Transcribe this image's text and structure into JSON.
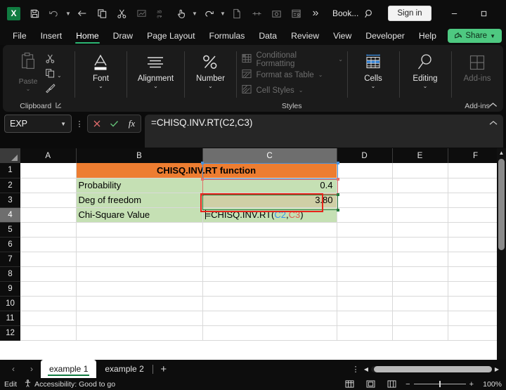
{
  "titlebar": {
    "app_logo": "excel-logo",
    "document_name": "Book...",
    "quick_access": [
      {
        "name": "save-icon",
        "label": "Save"
      },
      {
        "name": "undo-icon",
        "label": "Undo"
      },
      {
        "name": "back-arrow-icon",
        "label": "Back"
      },
      {
        "name": "copy-icon",
        "label": "Copy"
      },
      {
        "name": "cut-scissors-icon",
        "label": "Cut"
      },
      {
        "name": "chart-icon",
        "label": "Insert Chart"
      },
      {
        "name": "spelling-abc-icon",
        "label": "Spelling"
      },
      {
        "name": "touch-mode-icon",
        "label": "Touch/Mouse Mode"
      },
      {
        "name": "redo-icon",
        "label": "Redo"
      },
      {
        "name": "new-file-icon",
        "label": "New"
      },
      {
        "name": "merge-cells-icon",
        "label": "Merge"
      },
      {
        "name": "screenshot-icon",
        "label": "Screenshot"
      },
      {
        "name": "form-icon",
        "label": "Form"
      },
      {
        "name": "more-commands-icon",
        "label": "More"
      }
    ],
    "search_icon": "search-icon",
    "signin_label": "Sign in",
    "window_buttons": {
      "minimize": "–",
      "maximize": "◻",
      "close": "✕"
    }
  },
  "ribbon_tabs": {
    "items": [
      {
        "label": "File",
        "active": false
      },
      {
        "label": "Insert",
        "active": false
      },
      {
        "label": "Home",
        "active": true
      },
      {
        "label": "Draw",
        "active": false
      },
      {
        "label": "Page Layout",
        "active": false
      },
      {
        "label": "Formulas",
        "active": false
      },
      {
        "label": "Data",
        "active": false
      },
      {
        "label": "Review",
        "active": false
      },
      {
        "label": "View",
        "active": false
      },
      {
        "label": "Developer",
        "active": false
      },
      {
        "label": "Help",
        "active": false
      }
    ],
    "share_label": "Share",
    "share_color": "#4ec981"
  },
  "ribbon": {
    "clipboard": {
      "paste_label": "Paste",
      "group_label": "Clipboard",
      "icons": [
        "copy-icon",
        "format-painter-icon"
      ],
      "dialog_launcher": "dialog-launcher-icon"
    },
    "font": {
      "label": "Font"
    },
    "alignment": {
      "label": "Alignment"
    },
    "number": {
      "label": "Number"
    },
    "styles": {
      "group_label": "Styles",
      "items": [
        {
          "label": "Conditional Formatting",
          "icon": "conditional-formatting-icon"
        },
        {
          "label": "Format as Table",
          "icon": "format-as-table-icon"
        },
        {
          "label": "Cell Styles",
          "icon": "cell-styles-icon"
        }
      ]
    },
    "cells": {
      "label": "Cells"
    },
    "editing": {
      "label": "Editing"
    },
    "addins": {
      "label": "Add-ins",
      "group_label": "Add-ins"
    },
    "collapse_icon": "chevron-up-icon"
  },
  "formula_bar": {
    "name_box_value": "EXP",
    "cancel_icon": "cancel-x-icon",
    "enter_icon": "enter-check-icon",
    "fx_label": "fx",
    "formula": "=CHISQ.INV.RT(C2,C3)",
    "expand_icon": "chevron-down-icon"
  },
  "grid": {
    "columns": [
      "A",
      "B",
      "C",
      "D",
      "E",
      "F"
    ],
    "selected_column": "C",
    "rows": [
      "1",
      "2",
      "3",
      "4",
      "5",
      "6",
      "7",
      "8",
      "9",
      "10",
      "11",
      "12"
    ],
    "selected_row": "4",
    "cells": {
      "B1": "CHISQ.INV.RT function",
      "B2": "Probability",
      "B3": "Deg of freedom",
      "B4": "Chi-Square Value",
      "C2": "0.4",
      "C3": "3.80"
    },
    "editing_cell": {
      "address": "C4",
      "prefix": "=CHISQ.INV.RT(",
      "ref1": "C2",
      "comma": ",",
      "ref2": "C3",
      "suffix": ")"
    },
    "colors": {
      "header_fill": "#ED7D31",
      "label_fill": "#C5E0B4",
      "value_fill": "#C5E0B4",
      "ref_fill": "#CFCFA6",
      "ref1_border": "#4a90d9",
      "ref2_border": "#e0736b",
      "edit_border": "#e8241a"
    }
  },
  "sheet_tabs": {
    "prev_icon": "chevron-left-icon",
    "next_icon": "chevron-right-icon",
    "tabs": [
      {
        "label": "example 1",
        "active": true
      },
      {
        "label": "example 2",
        "active": false
      }
    ],
    "add_label": "+",
    "options_icon": "more-dots-icon"
  },
  "status_bar": {
    "mode": "Edit",
    "accessibility_icon": "accessibility-icon",
    "accessibility_text": "Accessibility: Good to go",
    "views": [
      {
        "name": "normal-view-icon",
        "active": true
      },
      {
        "name": "page-layout-view-icon",
        "active": false
      },
      {
        "name": "page-break-view-icon",
        "active": false
      }
    ],
    "zoom_out": "−",
    "zoom_in": "+",
    "zoom_value": "100%"
  }
}
